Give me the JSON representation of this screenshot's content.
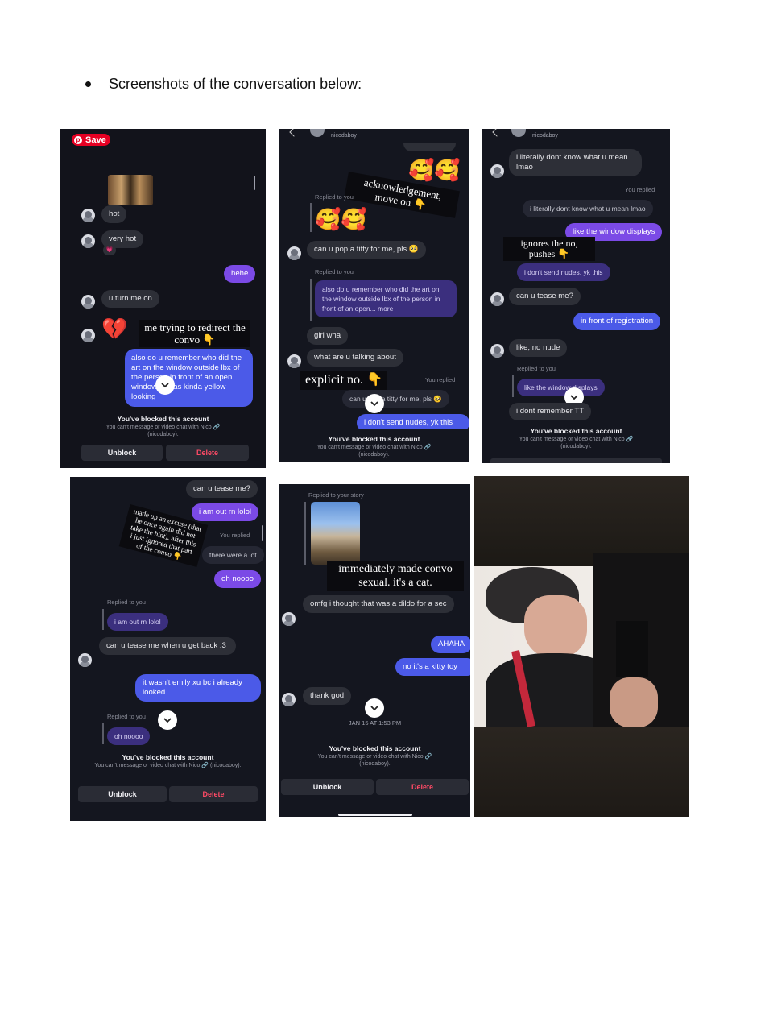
{
  "heading": "Screenshots of the conversation below:",
  "colors": {
    "purple": "#7b4ae6",
    "blue": "#4b5ae8",
    "quoted": "#3b2f7e",
    "incoming": "#2d2f37",
    "background": "#14161f",
    "delete": "#ff4a66",
    "pinterest": "#e60023"
  },
  "icons": {
    "chevron": "chevron-down-icon",
    "pinterest": "pinterest-icon",
    "link": "link-icon",
    "heart": "pink-heart-icon"
  },
  "blocked": {
    "title": "You've blocked this account",
    "subtitle": "You can't message or video chat with Nico 🔗 (nicodaboy).",
    "unblock": "Unblock",
    "delete": "Delete"
  },
  "shot1": {
    "save": "Save",
    "msg_hot": "hot",
    "msg_very_hot": "very hot",
    "heart_reaction": "💗",
    "msg_hehe": "hehe",
    "msg_turn_on": "u turn me on",
    "broken_heart": "💔",
    "caption": "me trying to redirect the convo 👇",
    "msg_art": "also do u remember who did the art on the window outside lbx of the person in front of an open window ... was kinda yellow looking"
  },
  "shot2": {
    "username": "nicodaboy",
    "emoji_top": "🥰🥰",
    "caption_ack": "acknowledgement, move on 👇",
    "replied_to_you": "Replied to you",
    "emoji_mid": "🥰🥰",
    "msg_pop": "can u pop a titty for me, pls 🥺",
    "replied_to_you_2": "Replied to you",
    "quoted_art": "also do u remember who did the art on the window outside lbx of the person in front of an open... more",
    "msg_girl_wha": "girl wha",
    "msg_what": "what are u talking about",
    "caption_no": "explicit no. 👇",
    "you_replied": "You replied",
    "ghost_pop": "can u pop a titty for me, pls 🥺",
    "msg_nudes": "i don't send nudes, yk this"
  },
  "shot3": {
    "username": "nicodaboy",
    "msg_literally": "i literally dont know what u mean lmao",
    "you_replied": "You replied",
    "ghost_literally": "i literally dont know what u mean lmao",
    "msg_window": "like the window displays",
    "caption": "ignores the no, pushes 👇",
    "msg_nudes": "i don't send nudes, yk this",
    "msg_tease": "can u tease me?",
    "msg_registration": "in front of registration",
    "msg_no_nude": "like, no nude",
    "replied_to_you": "Replied to you",
    "quoted_window": "like the window displays",
    "msg_remember": "i dont remember TT"
  },
  "shot4": {
    "msg_tease": "can u tease me?",
    "msg_out": "i am out rn lolol",
    "caption": "made up an excuse (that he once again did not take the hint), after this i just ignored that part of the convo 👇",
    "you_replied": "You replied",
    "ghost_lot": "there were a lot",
    "msg_oh": "oh noooo",
    "replied_to_you": "Replied to you",
    "quoted_out": "i am out rn lolol",
    "msg_get_back": "can u tease me when u get back :3",
    "msg_emily": "it wasn't emily xu bc i already looked",
    "replied_to_you_2": "Replied to you",
    "quoted_oh": "oh noooo"
  },
  "shot5": {
    "replied_story": "Replied to your story",
    "caption": "immediately made convo sexual. it's a cat.",
    "msg_omfg": "omfg i thought that was a dildo for a sec",
    "msg_ahaha": "AHAHA",
    "msg_kitty": "no it's a kitty toy",
    "msg_thank": "thank god",
    "timestamp": "JAN 15 AT 1:53 PM"
  }
}
